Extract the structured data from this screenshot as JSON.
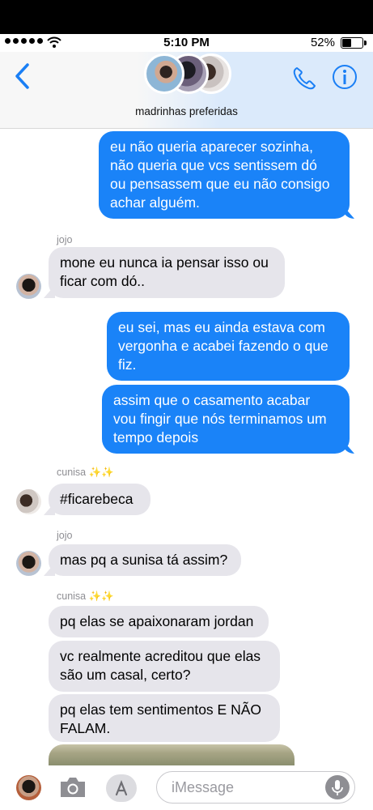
{
  "status_bar": {
    "time": "5:10 PM",
    "battery_percent": "52%",
    "battery_level": 0.52
  },
  "header": {
    "group_name": "madrinhas preferidas"
  },
  "messages": [
    {
      "from": "me",
      "text": "eu não queria aparecer sozinha,\nnão queria que vcs sentissem dó\nou pensassem que eu não consigo\nachar alguém."
    },
    {
      "from": "jojo",
      "sender_label": "jojo",
      "text": "mone eu nunca ia pensar isso ou\nficar com dó.."
    },
    {
      "from": "me",
      "text": "eu sei, mas eu ainda estava com\nvergonha e acabei fazendo o que\nfiz."
    },
    {
      "from": "me",
      "text": "assim que o casamento acabar\nvou fingir que nós terminamos um\ntempo depois"
    },
    {
      "from": "cunisa",
      "sender_label": "cunisa ✨✨",
      "text": "#ficarebeca"
    },
    {
      "from": "jojo",
      "sender_label": "jojo",
      "text": "mas pq a sunisa tá assim?"
    },
    {
      "from": "cunisa",
      "sender_label": "cunisa ✨✨",
      "text": "pq elas se apaixonaram jordan"
    },
    {
      "from": "cunisa",
      "text": "vc realmente acreditou que elas\nsão um casal, certo?"
    },
    {
      "from": "cunisa",
      "text": "pq elas tem sentimentos E NÃO\nFALAM."
    }
  ],
  "input": {
    "placeholder": "iMessage"
  },
  "icons": {
    "back": "chevron-left-icon",
    "phone": "phone-icon",
    "info": "info-icon",
    "camera": "camera-icon",
    "apps": "app-store-icon",
    "mic": "microphone-icon"
  },
  "colors": {
    "outgoing_bubble": "#1a83f8",
    "incoming_bubble": "#e6e5eb",
    "accent": "#1a7ff5"
  }
}
